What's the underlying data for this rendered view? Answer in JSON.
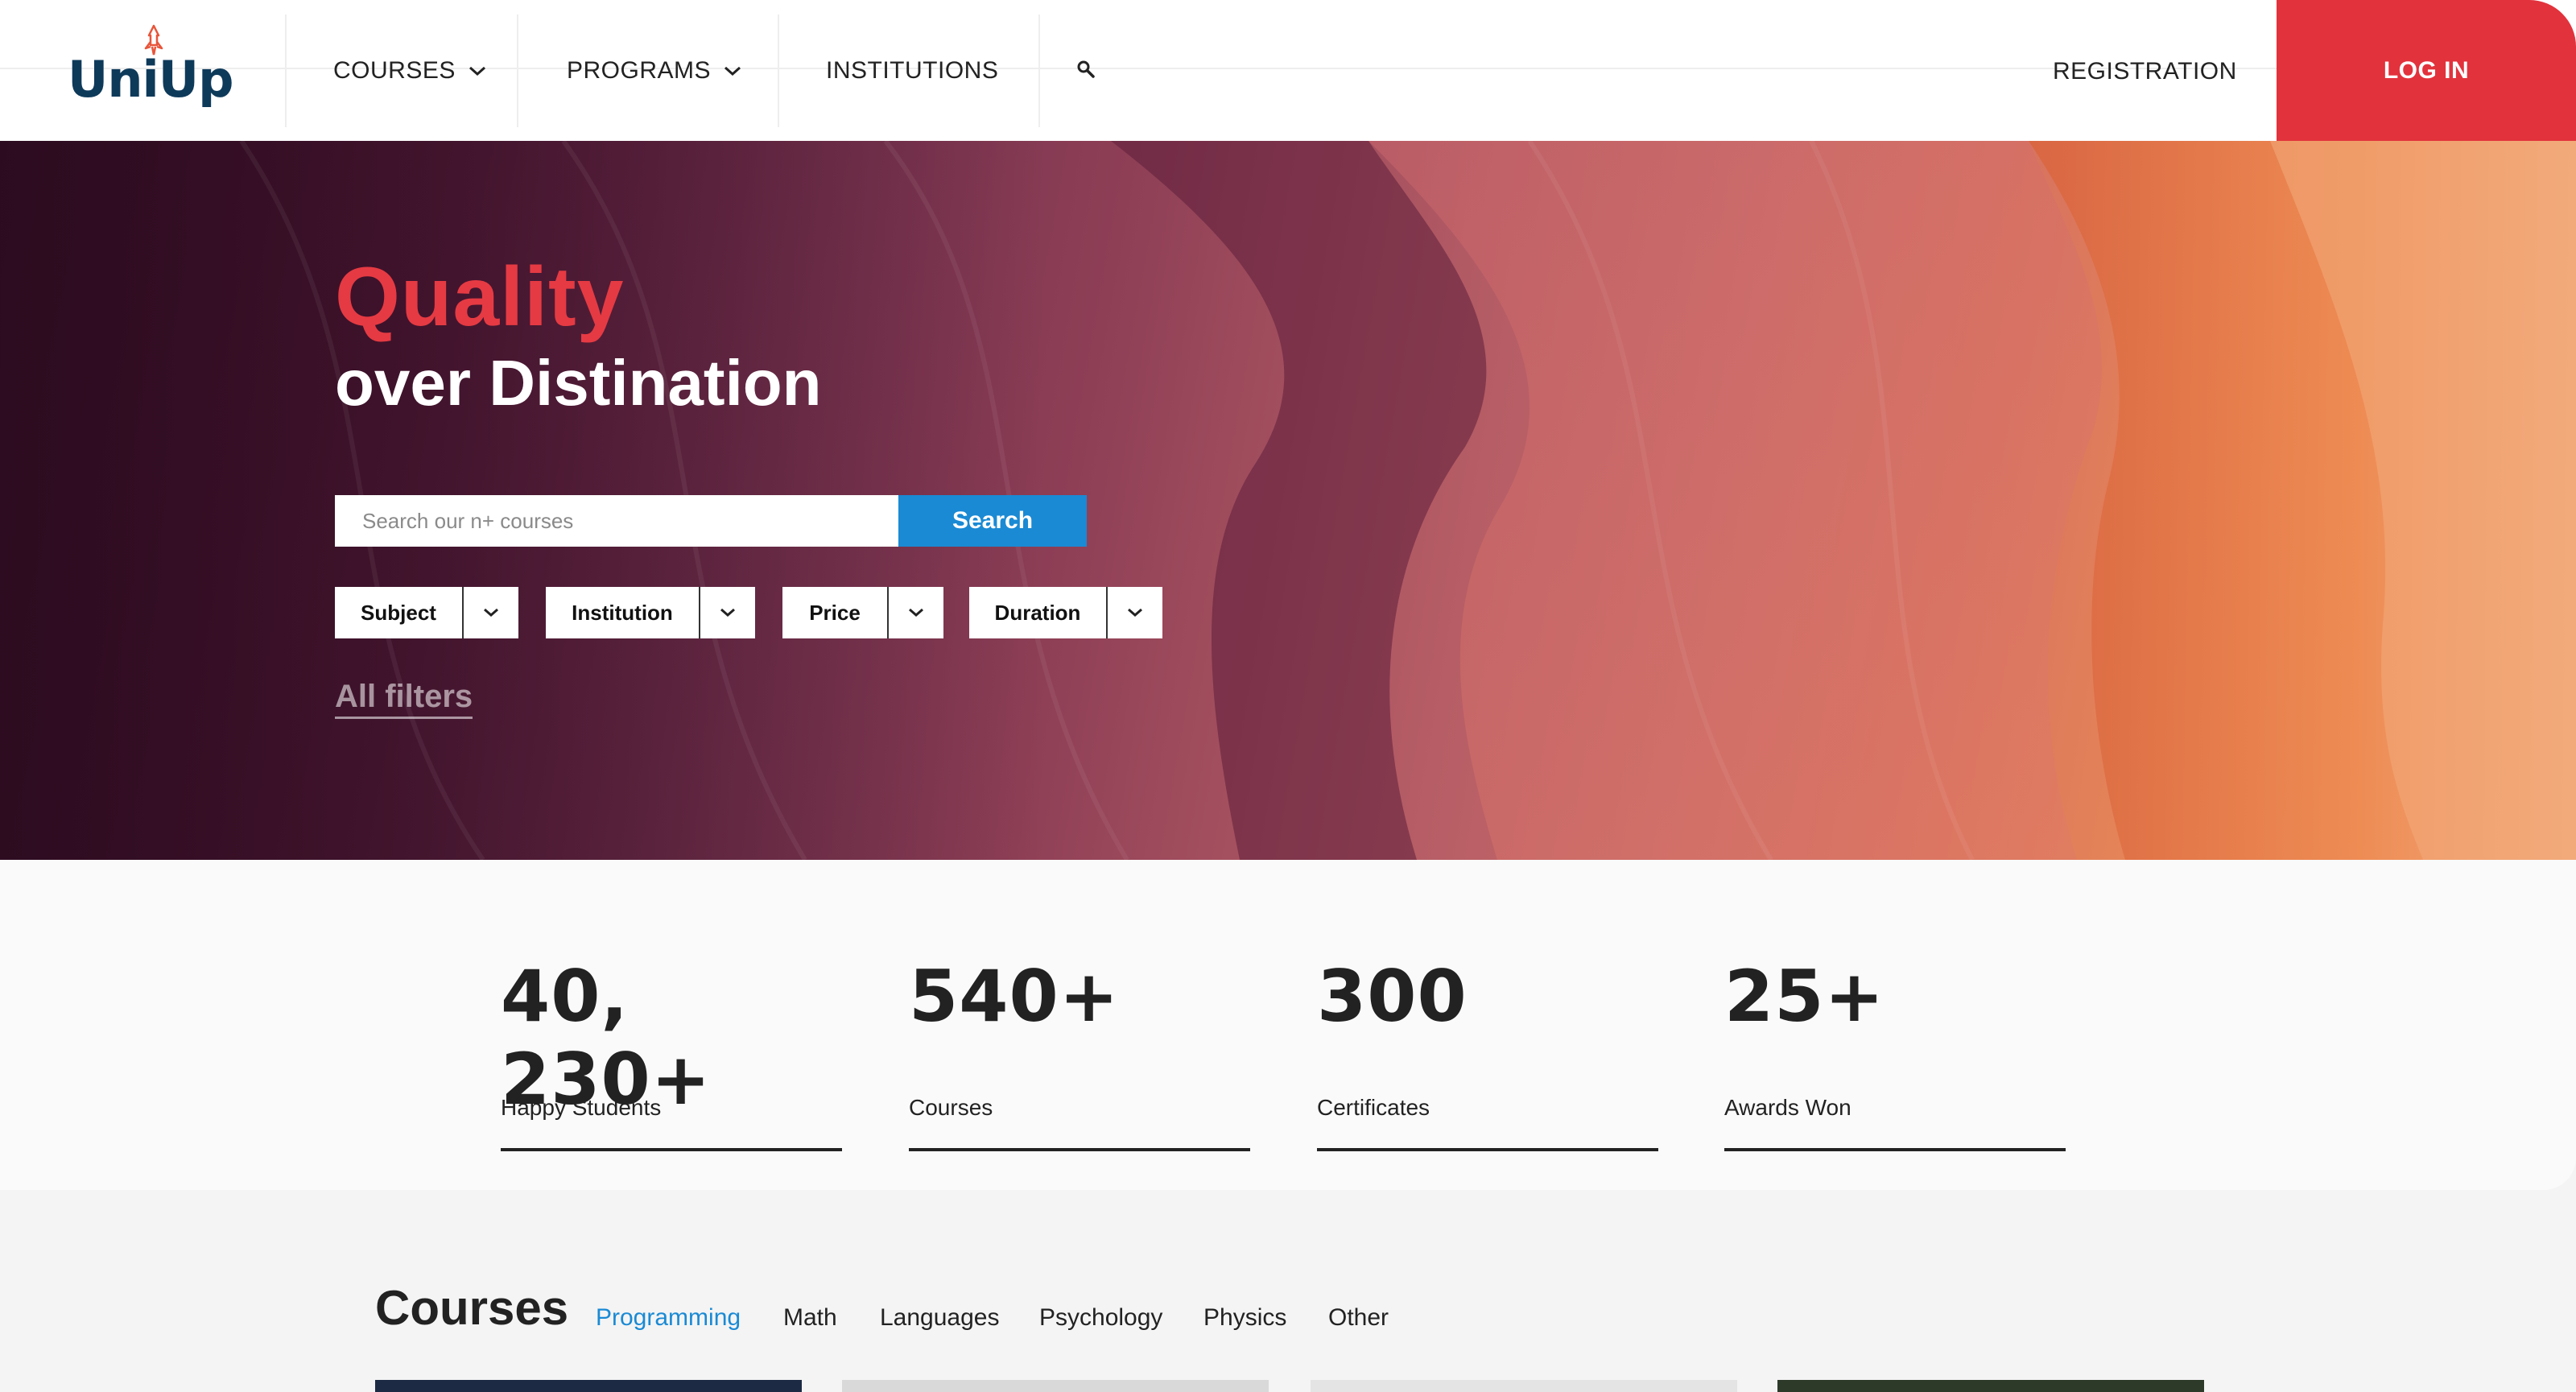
{
  "header": {
    "logo_text": "UniUp",
    "nav": {
      "courses": "COURSES",
      "programs": "PROGRAMS",
      "institutions": "INSTITUTIONS"
    },
    "registration": "REGISTRATION",
    "login": "LOG IN",
    "icons": [
      "rocket-icon",
      "chevron-down-icon",
      "search-icon"
    ]
  },
  "hero": {
    "title": "Quality",
    "subtitle": "over Distination",
    "search_placeholder": "Search our n+ courses",
    "search_button": "Search",
    "filters": [
      "Subject",
      "Institution",
      "Price",
      "Duration"
    ],
    "all_filters": "All filters"
  },
  "stats": [
    {
      "value": "40, 230+",
      "label": "Happy Students"
    },
    {
      "value": "540+",
      "label": "Courses"
    },
    {
      "value": "300",
      "label": "Certificates"
    },
    {
      "value": "25+",
      "label": "Awards Won"
    }
  ],
  "courses": {
    "title": "Courses",
    "tabs": [
      "Programming",
      "Math",
      "Languages",
      "Psychology",
      "Physics",
      "Other"
    ],
    "active_tab": "Programming"
  },
  "colors": {
    "brand_red": "#e2323c",
    "accent_blue": "#1a8ad4",
    "logo_navy": "#0e3a5a"
  }
}
